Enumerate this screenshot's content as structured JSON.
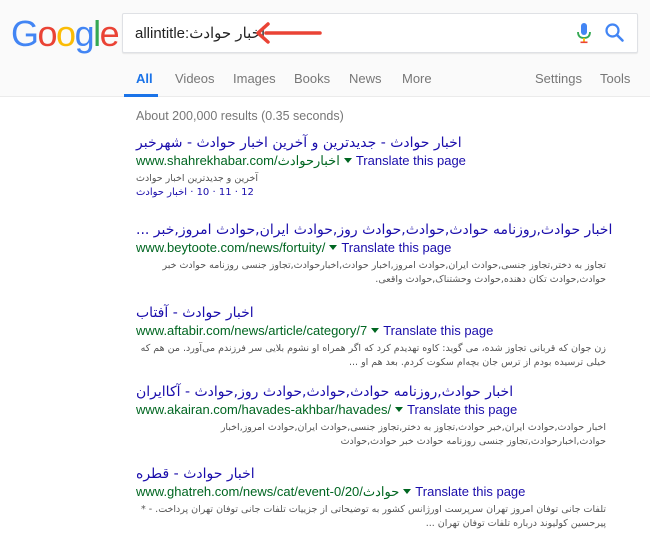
{
  "logo": {
    "letters": [
      "G",
      "o",
      "o",
      "g",
      "l",
      "e"
    ],
    "colors": [
      "#4285F4",
      "#EA4335",
      "#FBBC05",
      "#4285F4",
      "#34A853",
      "#EA4335"
    ]
  },
  "search": {
    "query": "allintitle:اخبار حوادث",
    "arrow_color": "#EA4335"
  },
  "tabs": [
    {
      "label": "All"
    },
    {
      "label": "Videos"
    },
    {
      "label": "Images"
    },
    {
      "label": "Books"
    },
    {
      "label": "News"
    },
    {
      "label": "More"
    },
    {
      "label": "Settings"
    },
    {
      "label": "Tools"
    }
  ],
  "stats": "About 200,000 results (0.35 seconds)",
  "results": [
    {
      "title": "اخبار حوادث - جدیدترین و آخرین اخبار حوادث - شهرخبر",
      "url": "www.shahrekhabar.com/اخبارحوادث",
      "translate": "Translate this page",
      "snippet": "آخرین و جدیدترین اخبار حوادث",
      "sitelinks": "12 · 11 · 10 · اخبار حوادث"
    },
    {
      "title": "اخبار حوادث,روزنامه حوادث,حوادث,حوادث روز,حوادث ایران,حوادث امروز,خبر ...",
      "url": "www.beytoote.com/news/fortuity/",
      "translate": "Translate this page",
      "snippet": "تجاوز به دختر,تجاوز جنسی,حوادث ایران,حوادث امروز,اخبار حوادث,اخبارحوادث,تجاوز جنسی روزنامه حوادث خبر حوادث,حوادث تکان دهنده,حوادث وحشتناک,حوادث واقعی."
    },
    {
      "title": "اخبار حوادث - آفتاب",
      "url": "www.aftabir.com/news/article/category/7",
      "translate": "Translate this page",
      "snippet": "زن جوان که قربانی تجاوز شده، می گوید: کاوه تهدیدم کرد که اگر همراه او نشوم بلایی سر فرزندم می‌آورد. من هم که خیلی ترسیده بودم از ترس جان بچه‌ام سکوت کردم. بعد هم او ..."
    },
    {
      "title": "اخبار حوادث,روزنامه حوادث,حوادث,حوادث روز,حوادث - آکاایران",
      "url": "www.akairan.com/havades-akhbar/havades/",
      "translate": "Translate this page",
      "snippet": "اخبار حوادث,حوادث ایران,خبر حوادث,تجاوز به دختر,تجاوز جنسی,حوادث ایران,حوادث امروز,اخبار حوادث,اخبارحوادث,تجاوز جنسی روزنامه حوادث خبر حوادث,حوادث"
    },
    {
      "title": "اخبار حوادث - قطره",
      "url": "www.ghatreh.com/news/cat/event-0/20/حوادث",
      "translate": "Translate this page",
      "snippet": "تلفات جانی توفان امروز تهران سرپرست اورژانس کشور به توضیحاتی از جزییات تلفات جانی توفان تهران پرداخت. - * پیرحسین کولیوند درباره تلفات توفان تهران ..."
    }
  ]
}
